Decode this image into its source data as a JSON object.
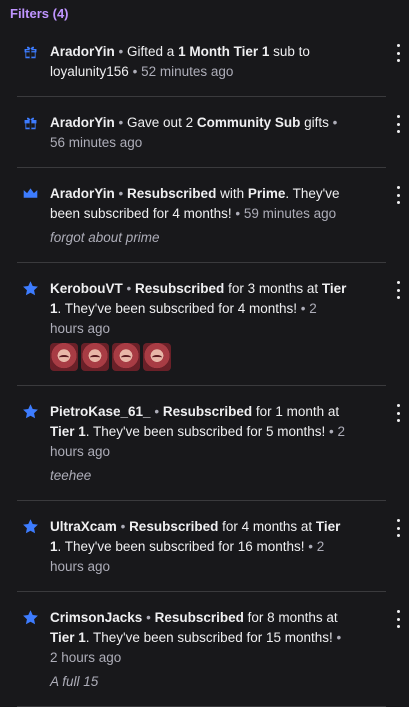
{
  "header": {
    "filters_label": "Filters (4)"
  },
  "colors": {
    "accent": "#bf94ff",
    "icon": "#3d7cff",
    "background": "#18181b"
  },
  "items": [
    {
      "icon": "gift-icon",
      "user": "AradorYin",
      "sep": "•",
      "pre": "Gifted a",
      "strong1": "1 Month Tier 1",
      "mid": "sub to",
      "strong2": "",
      "post": "loyalunity156",
      "time": "52 minutes ago"
    },
    {
      "icon": "gift-icon",
      "user": "AradorYin",
      "sep": "•",
      "pre": "Gave out 2",
      "strong1": "Community Sub",
      "mid": "gifts",
      "time": "56 minutes ago"
    },
    {
      "icon": "crown-icon",
      "user": "AradorYin",
      "sep": "•",
      "strong1": "Resubscribed",
      "mid": "with",
      "strong2": "Prime",
      "post": ". They've been subscribed for 4 months!",
      "time": "59 minutes ago",
      "note": "forgot about prime"
    },
    {
      "icon": "star-icon",
      "user": "KerobouVT",
      "sep": "•",
      "strong1": "Resubscribed",
      "mid": "for 3 months at",
      "strong2": "Tier 1",
      "post": ". They've been subscribed for 4 months!",
      "time": "2 hours ago",
      "emotes": [
        "emote",
        "emote",
        "emote",
        "emote"
      ]
    },
    {
      "icon": "star-icon",
      "user": "PietroKase_61_",
      "sep": "•",
      "strong1": "Resubscribed",
      "mid": "for 1 month at",
      "strong2": "Tier 1",
      "post": ". They've been subscribed for 5 months!",
      "time": "2 hours ago",
      "note": "teehee"
    },
    {
      "icon": "star-icon",
      "user": "UltraXcam",
      "sep": "•",
      "strong1": "Resubscribed",
      "mid": "for 4 months at",
      "strong2": "Tier 1",
      "post": ". They've been subscribed for 16 months!",
      "time": "2 hours ago"
    },
    {
      "icon": "star-icon",
      "user": "CrimsonJacks",
      "sep": "•",
      "strong1": "Resubscribed",
      "mid": "for 8 months at",
      "strong2": "Tier 1",
      "post": ". They've been subscribed for 15 months!",
      "time": "2 hours ago",
      "note": "A full 15"
    }
  ]
}
